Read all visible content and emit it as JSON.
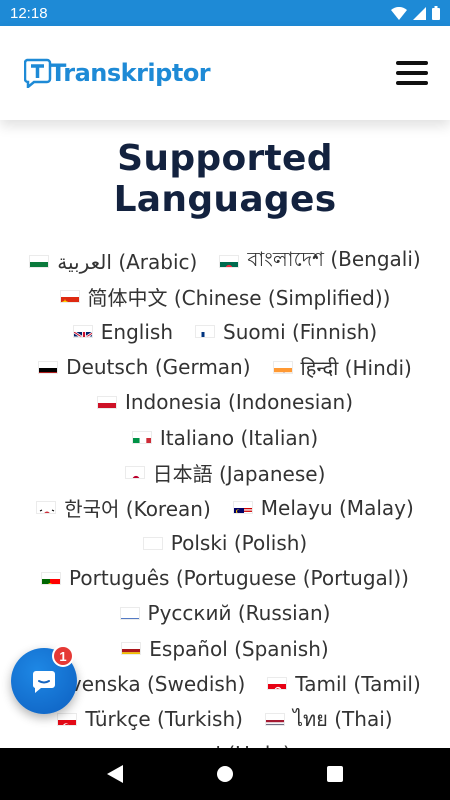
{
  "status_bar": {
    "time": "12:18"
  },
  "header": {
    "logo_text": "Transkriptor",
    "logo_initial": "T"
  },
  "main": {
    "title": "Supported Languages",
    "rows": [
      [
        {
          "label": "العربية (Arabic)",
          "flag": "sa"
        },
        {
          "label": "বাংলাদেশ (Bengali)",
          "flag": "bd"
        }
      ],
      [
        {
          "label": "简体中文 (Chinese (Simplified))",
          "flag": "cn"
        }
      ],
      [
        {
          "label": "English",
          "flag": "gb"
        },
        {
          "label": "Suomi (Finnish)",
          "flag": "fi"
        }
      ],
      [
        {
          "label": "Deutsch (German)",
          "flag": "de"
        },
        {
          "label": "हिन्दी (Hindi)",
          "flag": "in"
        }
      ],
      [
        {
          "label": "Indonesia (Indonesian)",
          "flag": "id"
        }
      ],
      [
        {
          "label": "Italiano (Italian)",
          "flag": "it"
        }
      ],
      [
        {
          "label": "日本語 (Japanese)",
          "flag": "jp"
        }
      ],
      [
        {
          "label": "한국어 (Korean)",
          "flag": "kr"
        },
        {
          "label": "Melayu (Malay)",
          "flag": "my"
        }
      ],
      [
        {
          "label": "Polski (Polish)",
          "flag": "pl"
        }
      ],
      [
        {
          "label": "Português (Portuguese (Portugal))",
          "flag": "pt"
        }
      ],
      [
        {
          "label": "Русский (Russian)",
          "flag": "ru"
        }
      ],
      [
        {
          "label": "Español (Spanish)",
          "flag": "es"
        }
      ],
      [
        {
          "label": "Svenska (Swedish)",
          "flag": "se"
        },
        {
          "label": "Tamil (Tamil)",
          "flag": "tn"
        }
      ],
      [
        {
          "label": "Türkçe (Turkish)",
          "flag": "tr"
        },
        {
          "label": "ไทย (Thai)",
          "flag": "th"
        }
      ],
      [
        {
          "label": "اردو (Urdu)",
          "flag": "pk"
        }
      ]
    ]
  },
  "chat": {
    "badge_count": "1",
    "icon": "chat-bubble-icon"
  },
  "colors": {
    "brand": "#1e8ad6",
    "title": "#13223f",
    "text": "#333333",
    "badge": "#e53935"
  }
}
